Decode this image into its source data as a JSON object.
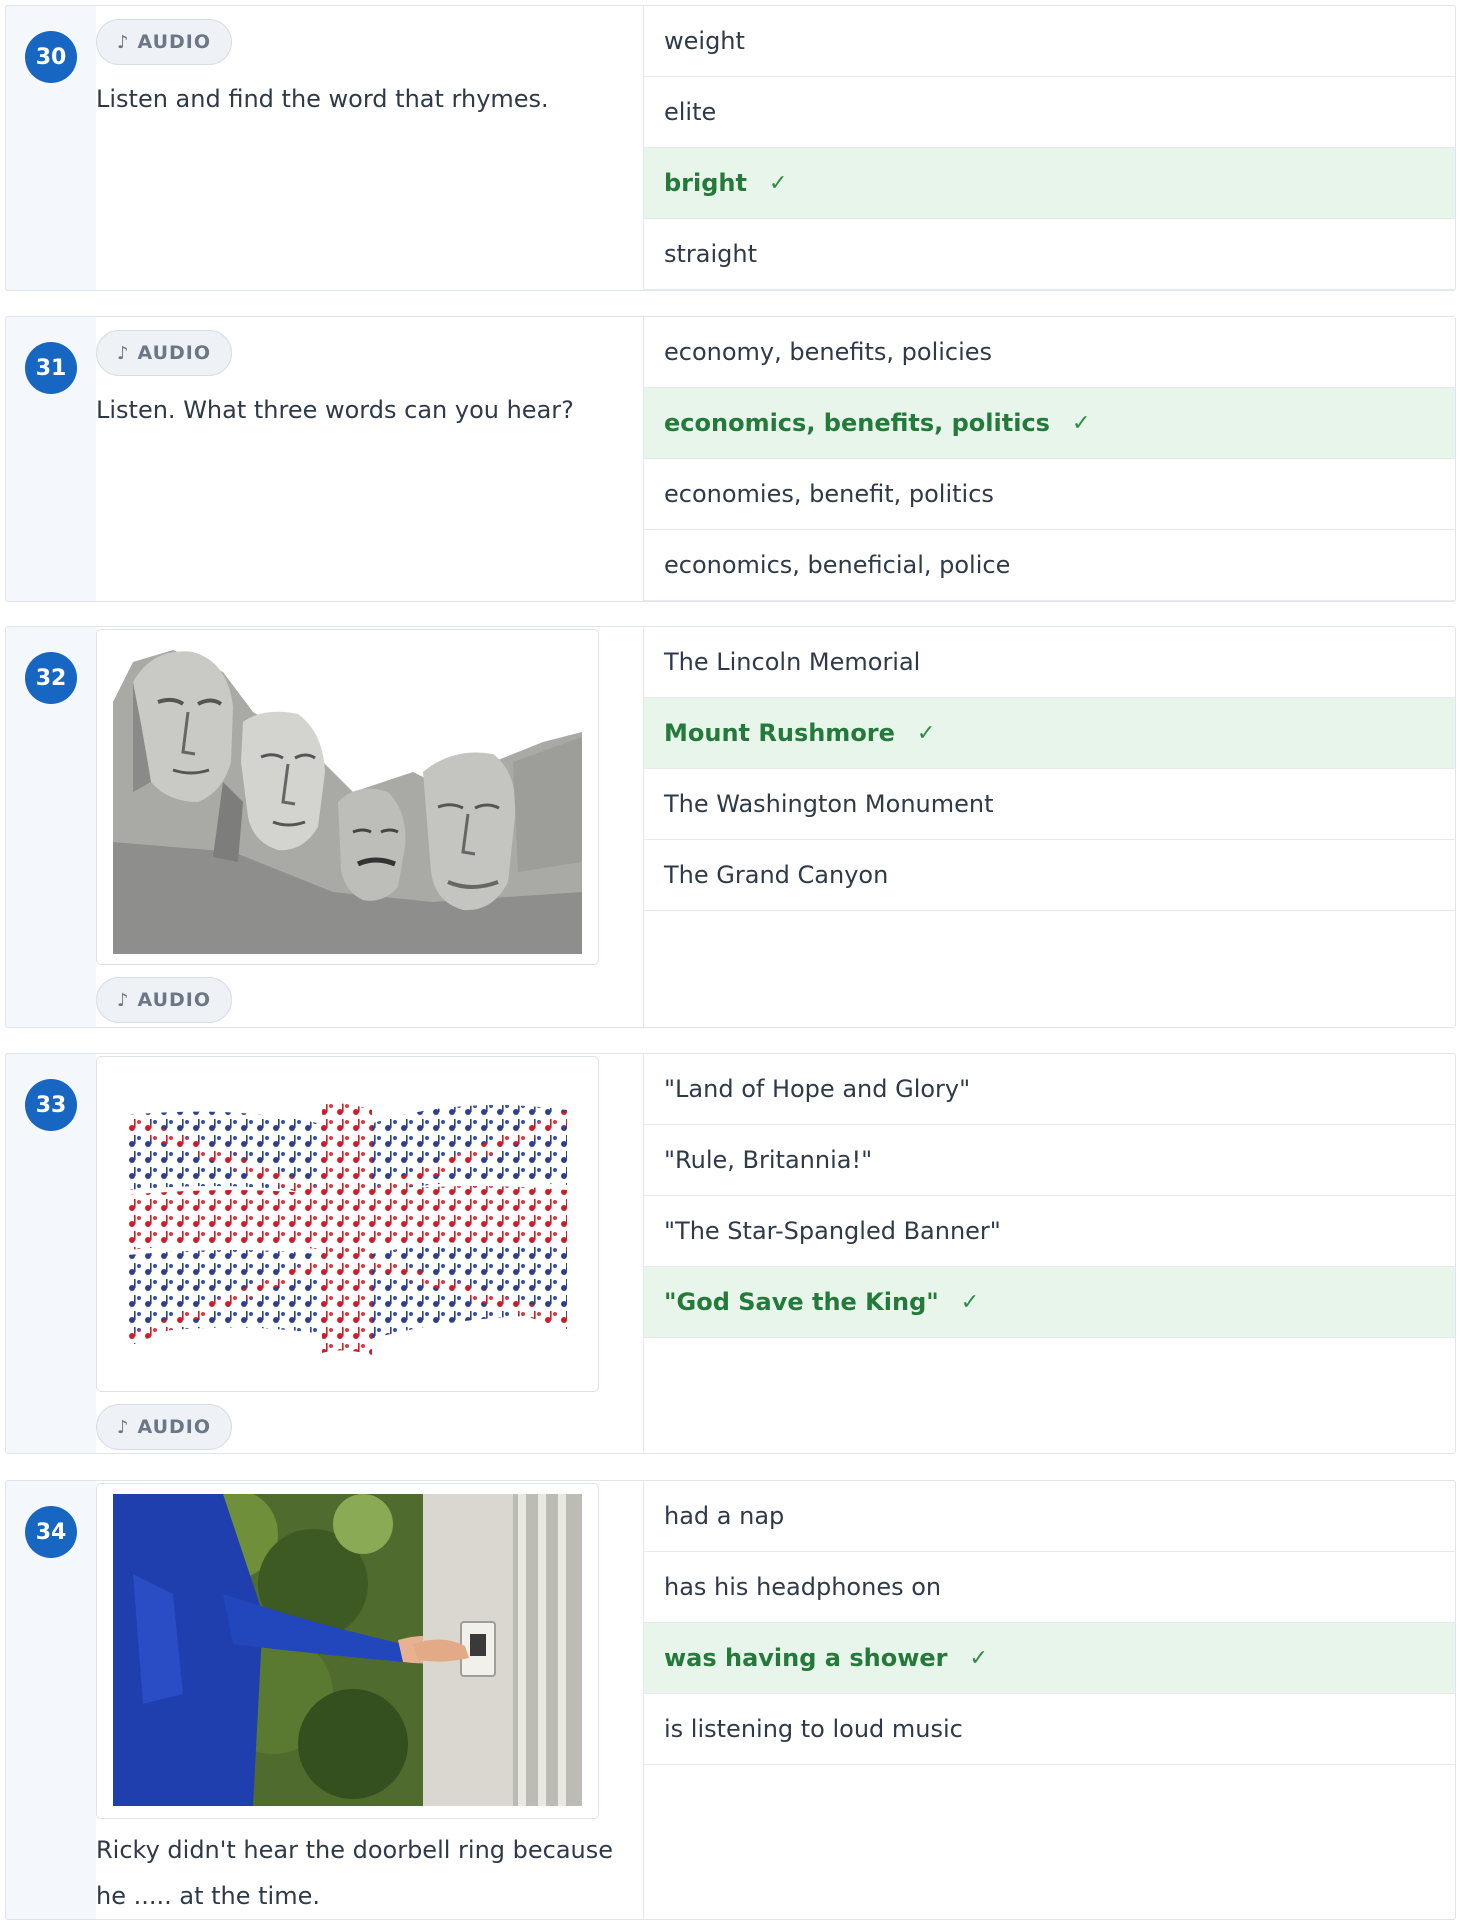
{
  "audio_label": "AUDIO",
  "questions": [
    {
      "number": "30",
      "prompt": "Listen and find the word that rhymes.",
      "options": [
        "weight",
        "elite",
        "bright",
        "straight"
      ],
      "correct_index": 2
    },
    {
      "number": "31",
      "prompt": "Listen. What three words can you hear?",
      "options": [
        "economy, benefits, policies",
        "economics, benefits, politics",
        "economies, benefit, politics",
        "economics, beneficial, police"
      ],
      "correct_index": 1
    },
    {
      "number": "32",
      "image": "mount-rushmore-illustration",
      "options": [
        "The Lincoln Memorial",
        "Mount Rushmore",
        "The Washington Monument",
        "The Grand Canyon"
      ],
      "correct_index": 1
    },
    {
      "number": "33",
      "image": "union-jack-music-notes",
      "options": [
        "\"Land of Hope and Glory\"",
        "\"Rule, Britannia!\"",
        "\"The Star-Spangled Banner\"",
        "\"God Save the King\""
      ],
      "correct_index": 3
    },
    {
      "number": "34",
      "image": "boy-pressing-doorbell-photo",
      "prompt_line1": "Ricky didn't hear the doorbell ring because",
      "prompt_line2": "he ..... at the time.",
      "options": [
        "had a nap",
        "has his headphones on",
        "was having a shower",
        "is listening to loud music"
      ],
      "correct_index": 2
    }
  ],
  "check_mark": "✓",
  "colors": {
    "badge": "#1766c2",
    "correct_bg": "#e8f5ea",
    "correct_text": "#247a3a",
    "number_column_bg": "#f4f7fb"
  }
}
